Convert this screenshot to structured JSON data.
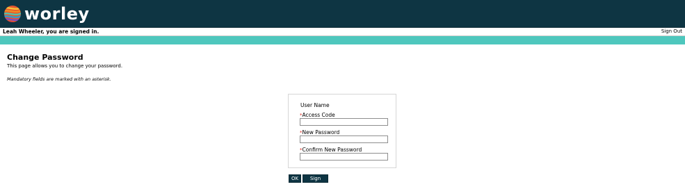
{
  "header": {
    "logo_text": "worley",
    "background_color": "#0e3543",
    "logo_icon": "worley-globe-icon"
  },
  "signed_bar": {
    "signed_in_text": "Leah Wheeler, you are signed in.",
    "sign_out_link": "Sign Out"
  },
  "accent_band": {
    "color": "#4ec7bd"
  },
  "page": {
    "title": "Change Password",
    "description": "This page allows you to change your password.",
    "mandatory_note": "Mandatory fields are marked with an asterisk."
  },
  "form": {
    "user_name_label": "User Name",
    "asterisk": "*",
    "access_code_label": "Access Code",
    "access_code_value": "",
    "new_password_label": "New Password",
    "new_password_value": "",
    "confirm_password_label": "Confirm New Password",
    "confirm_password_value": ""
  },
  "buttons": {
    "ok_label": "OK",
    "sign_out_label": "Sign Out"
  }
}
